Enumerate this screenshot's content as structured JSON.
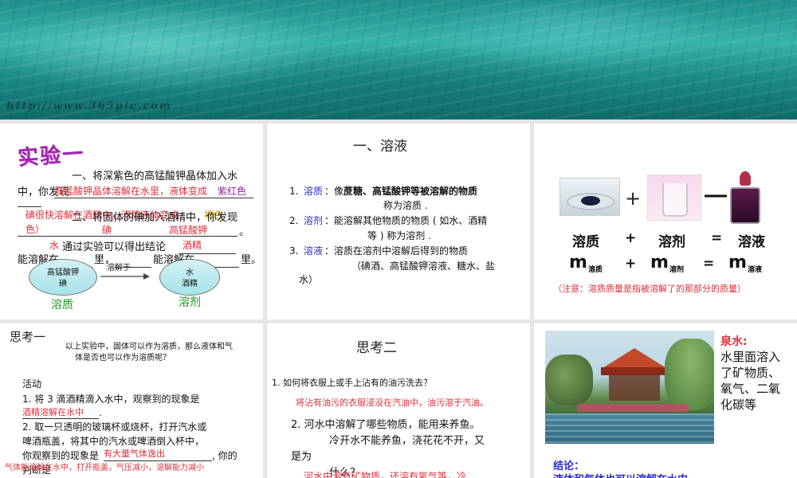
{
  "hero": {
    "watermark": "http://www.365pic.com"
  },
  "p1": {
    "title": "实验一",
    "line1": "一、将深紫色的高锰酸钾晶体加入水",
    "line2a": "中，你发现",
    "ans1": "高锰酸钾晶体溶解在水里，液体变成",
    "ans1b": "紫红色",
    "ans2": "碘很快溶解在酒精中，酒精液体变成",
    "ans2b": "褐色",
    "ans2c": "色）",
    "line3": "二、将固体的碘加入酒精中，你发现",
    "line3end": "。",
    "ans3": "碘",
    "ans4": "高锰酸钾",
    "ans5": "水",
    "line4": "通过实验可以得出结论",
    "ans6": "酒精",
    "line5a": "能溶解在",
    "line5b": "里，",
    "line5c": "能溶解在",
    "line5d": "里。",
    "ell1_top": "高锰酸钾",
    "ell1_bot": "碘",
    "arrow_label": "溶解于",
    "ell2_top": "水",
    "ell2_bot": "酒精",
    "label_solute": "溶质",
    "label_solvent": "溶剂"
  },
  "p2": {
    "heading": "一、溶液",
    "i1_num": "1.",
    "i1_key": "溶质",
    "i1_text": "：像",
    "i1_bold": "蔗糖、高锰酸钾等被溶解的物质",
    "i1_line2": "称为溶质 .",
    "i2_num": "2.",
    "i2_key": "溶剂",
    "i2_text": "：能溶解其他物质的物质 ( 如水、酒精",
    "i2_line2": "等 ) 称为溶剂 .",
    "i3_num": "3.",
    "i3_key": "溶液",
    "i3_text": "：溶质在溶剂中溶解后得到的物质",
    "i3_line2": "（碘酒、高锰酸钾溶液、糖水、盐",
    "i3_line3": "水）"
  },
  "p3": {
    "plus": "+",
    "w1": "溶质",
    "w_plus": "+",
    "w2": "溶剂",
    "w_eq": "=",
    "w3": "溶液",
    "m": "m",
    "s1": "溶质",
    "m_plus": "+",
    "s2": "溶剂",
    "m_eq": "=",
    "s3": "溶液",
    "note": "（注意：溶质质量是指被溶解了的那部分的质量）"
  },
  "p4": {
    "heading": "思考一",
    "q_line1": "以上实验中，固体可以作为溶质，那么液体和气",
    "q_line2": "体是否也可以作为溶质呢？",
    "activity": "活动",
    "a1": "1. 将 3 滴酒精滴入水中，观察到的现象是",
    "a1_ans": "酒精溶解在水中",
    "a1_dot": ".",
    "a2_line1": "2. 取一只透明的玻璃杯或烧杯，打开汽水或",
    "a2_line2": "啤酒瓶盖，将其中的汽水或啤酒倒入杯中，",
    "a2_line3": "你观察到的现象是",
    "a2_ans": "有大量气体逸出",
    "a2_line3b": ", 你的",
    "a2_line4": "判断是",
    "a2_ans2": "气体能溶解在水中，打开瓶盖，气压减小，溶解能力减小"
  },
  "p5": {
    "heading": "思考二",
    "q1": "1. 如何将衣服上或手上沾有的油污洗去？",
    "a1": "将沾有油污的衣服浸没在汽油中，油污溶于汽油。",
    "q2": "2. 河水中溶解了哪些物质，能用来养鱼。",
    "q2b": "冷开水不能养鱼，浇花花不开，又",
    "q2c": "是为",
    "q2d": "什么？",
    "a2": "河水中溶有矿物质，还溶有氧气等，冷"
  },
  "p6": {
    "title": "泉水:",
    "text": "水里面溶入了矿物质、氧气、二氧化碳等",
    "conclusion": "结论：",
    "conclusion_text": "液体和气体也可以溶解在水中"
  },
  "colors": {
    "red": "#e0303a",
    "blue": "#2a2ad0",
    "green": "#1a9a1a",
    "purple": "#a020a0",
    "gold": "#d49b00"
  }
}
